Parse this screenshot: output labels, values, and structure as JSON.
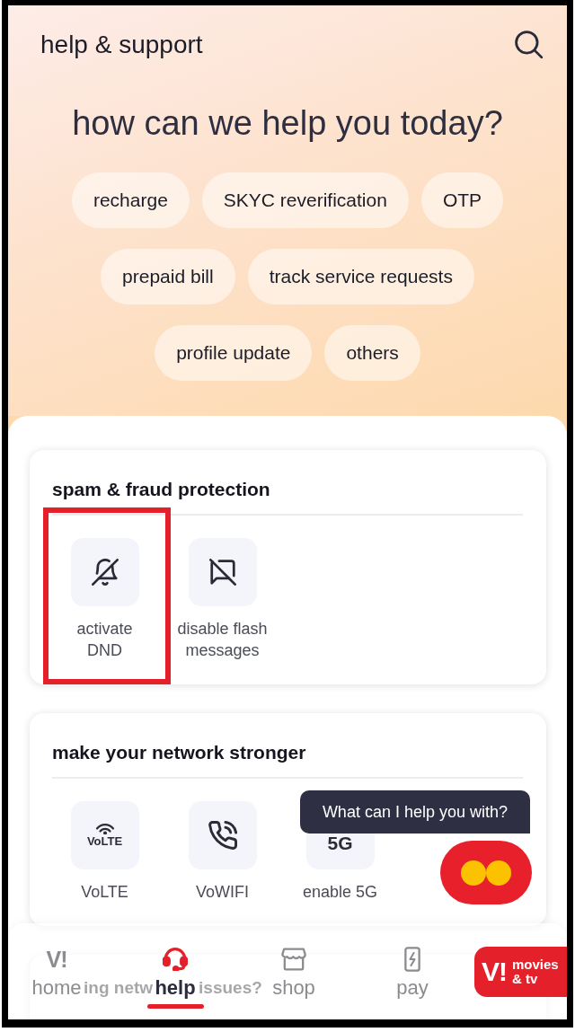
{
  "header": {
    "title": "help & support",
    "heading": "how can we help you today?"
  },
  "topics": [
    "recharge",
    "SKYC reverification",
    "OTP",
    "prepaid bill",
    "track service requests",
    "profile update",
    "others"
  ],
  "sections": [
    {
      "title": "spam & fraud protection",
      "items": [
        {
          "kind": "icon",
          "label": "activate DND",
          "highlighted": true
        },
        {
          "kind": "icon",
          "label": "disable flash messages",
          "highlighted": false
        }
      ]
    },
    {
      "title": "make your network stronger",
      "items": [
        {
          "kind": "icon_text",
          "icon_text": "VoLTE",
          "label": "VoLTE",
          "highlighted": false
        },
        {
          "kind": "icon",
          "label": "VoWIFI",
          "highlighted": false
        },
        {
          "kind": "text",
          "icon_text": "5G",
          "label": "enable 5G",
          "highlighted": false
        }
      ]
    }
  ],
  "covered_section": {
    "title_parts": [
      "ing netw",
      "issues?"
    ]
  },
  "chat": {
    "prompt": "What can I help you with?"
  },
  "nav": {
    "items": [
      {
        "kind": "logo",
        "logo": "V!",
        "label": "home",
        "selected": false
      },
      {
        "kind": "icon",
        "label": "help",
        "selected": true
      },
      {
        "kind": "icon",
        "label": "shop",
        "selected": false
      },
      {
        "kind": "icon",
        "label": "pay",
        "selected": false
      }
    ],
    "promo": {
      "logo": "V!",
      "label": "movies & tv"
    }
  }
}
